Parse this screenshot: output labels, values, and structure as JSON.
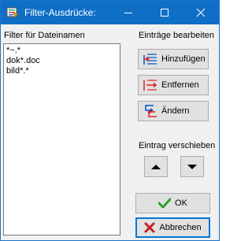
{
  "window": {
    "title": "Filter-Ausdrücke:"
  },
  "filter": {
    "label": "Filter für Dateinamen",
    "items": [
      "*~.*",
      "dok*.doc",
      "bild*.*"
    ]
  },
  "edit_group": {
    "label": "Einträge bearbeiten",
    "add_label": "Hinzufügen",
    "remove_label": "Entfernen",
    "change_label": "Ändern"
  },
  "move_group": {
    "label": "Eintrag verschieben"
  },
  "footer": {
    "ok_label": "OK",
    "cancel_label": "Abbrechen"
  },
  "colors": {
    "titlebar": "#0f6fc7",
    "accent_blue": "#0050c8",
    "accent_red": "#e02020",
    "ok_green": "#2ea02e",
    "cancel_red": "#c81e1e"
  },
  "icons": {
    "app": "filter-icon",
    "minimize": "minimize-icon",
    "maximize": "maximize-icon",
    "close": "close-icon",
    "add": "add-entry-icon",
    "remove": "remove-entry-icon",
    "change": "change-entry-icon",
    "up": "triangle-up-icon",
    "down": "triangle-down-icon",
    "ok": "checkmark-icon",
    "cancel": "x-icon"
  }
}
